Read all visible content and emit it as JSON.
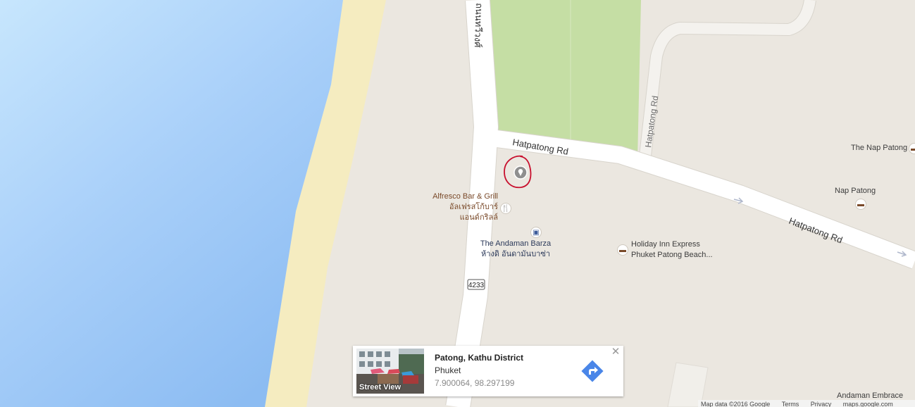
{
  "map": {
    "colors": {
      "sea": "#a9d0fa",
      "sand": "#f5ecc0",
      "land": "#ebe7e0",
      "park": "#c5dea4",
      "road": "#ffffff",
      "road_edge": "#d8d4cc",
      "marker_ring": "#c8102e"
    },
    "roads": [
      {
        "name": "ถนนทวีวงศ์",
        "type": "street-label-vertical"
      },
      {
        "name": "Hatpatong Rd",
        "type": "street-label"
      },
      {
        "name": "Hatpatong Rd",
        "type": "street-label"
      },
      {
        "name": "Hatpatong Rd",
        "type": "street-label-vertical"
      }
    ],
    "route_shield": "4233",
    "pois": [
      {
        "name_en": "Alfresco Bar & Grill",
        "name_th_1": "อัลเฟรสโก้บาร์",
        "name_th_2": "แอนด์กริลล์",
        "icon": "restaurant-icon"
      },
      {
        "name_en": "The Andaman Barza",
        "name_th": "ห้างดิ อันดามันบาซ่า",
        "icon": "shopping-icon"
      },
      {
        "name_en": "Holiday Inn Express",
        "name_en_2": "Phuket Patong Beach...",
        "icon": "hotel-icon"
      },
      {
        "name_en": "Nap Patong",
        "icon": "hotel-icon"
      },
      {
        "name_en": "The Nap Patong",
        "icon": "hotel-icon"
      },
      {
        "name_en": "Andaman Embrace"
      }
    ]
  },
  "info_card": {
    "street_view_label": "Street View",
    "title": "Patong, Kathu District",
    "subtitle": "Phuket",
    "coordinates": "7.900064, 98.297199",
    "directions_icon": "directions-icon",
    "close_icon": "close-icon"
  },
  "footer": {
    "map_data": "Map data ©2016 Google",
    "terms": "Terms",
    "privacy": "Privacy",
    "url": "maps.google.com"
  }
}
